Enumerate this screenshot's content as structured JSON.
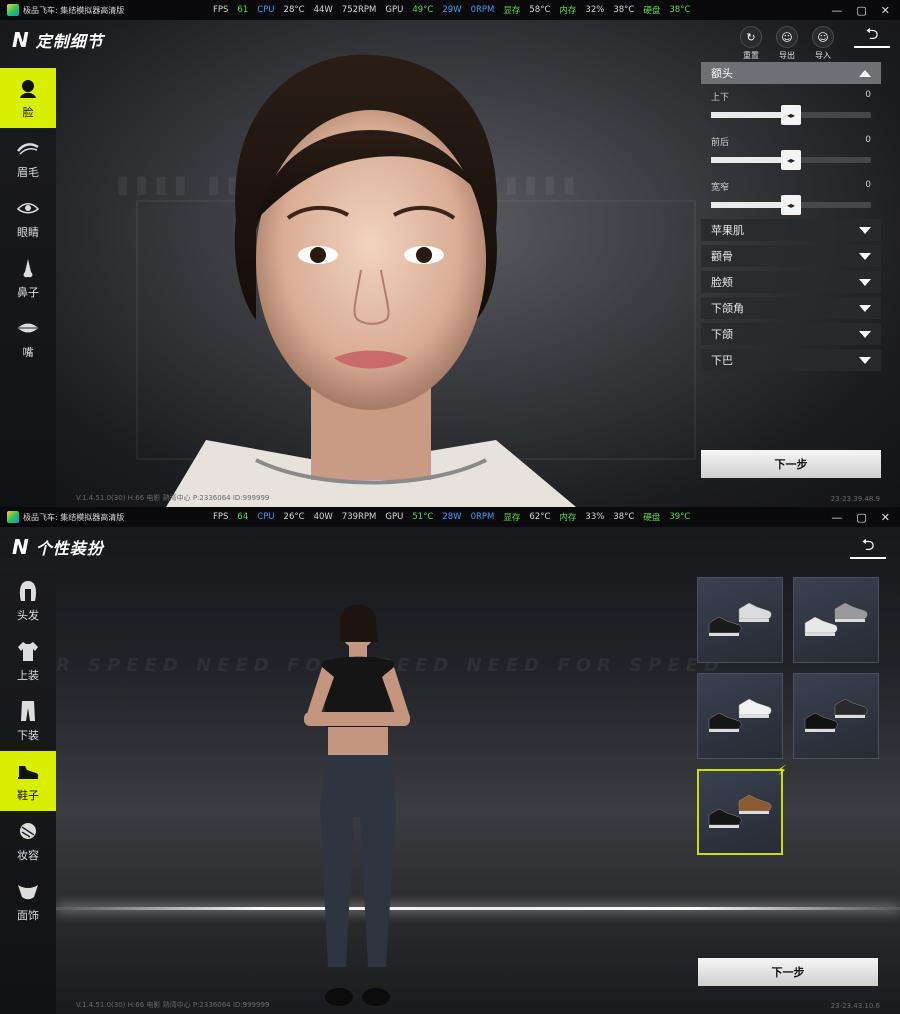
{
  "screen1": {
    "titlebar": {
      "app_name": "极品飞车: 集结模拟器高清版",
      "stats": [
        {
          "t": "FPS",
          "c": "w"
        },
        {
          "t": "61",
          "c": "g"
        },
        {
          "t": "CPU",
          "c": "b"
        },
        {
          "t": "28°C",
          "c": "w"
        },
        {
          "t": "44W",
          "c": "w"
        },
        {
          "t": "752RPM",
          "c": "w"
        },
        {
          "t": "GPU",
          "c": "w"
        },
        {
          "t": "49°C",
          "c": "g"
        },
        {
          "t": "29W",
          "c": "b"
        },
        {
          "t": "0RPM",
          "c": "b"
        },
        {
          "t": "显存",
          "c": "g"
        },
        {
          "t": "58°C",
          "c": "w"
        },
        {
          "t": "内存",
          "c": "g"
        },
        {
          "t": "32%",
          "c": "w"
        },
        {
          "t": "38°C",
          "c": "w"
        },
        {
          "t": "硬盘",
          "c": "g"
        },
        {
          "t": "38°C",
          "c": "g"
        }
      ]
    },
    "header_title": "定制细节",
    "sidebar": [
      {
        "label": "脸",
        "icon": "face-icon",
        "active": true
      },
      {
        "label": "眉毛",
        "icon": "eyebrow-icon",
        "active": false
      },
      {
        "label": "眼睛",
        "icon": "eye-icon",
        "active": false
      },
      {
        "label": "鼻子",
        "icon": "nose-icon",
        "active": false
      },
      {
        "label": "嘴",
        "icon": "mouth-icon",
        "active": false
      }
    ],
    "tools": [
      {
        "label": "重置",
        "icon": "reset-icon"
      },
      {
        "label": "导出",
        "icon": "export-icon"
      },
      {
        "label": "导入",
        "icon": "import-icon"
      }
    ],
    "panel": {
      "section": "额头",
      "sliders": [
        {
          "label": "上下",
          "value": "0",
          "fraction": 0.5
        },
        {
          "label": "前后",
          "value": "0",
          "fraction": 0.5
        },
        {
          "label": "宽窄",
          "value": "0",
          "fraction": 0.5
        }
      ],
      "collapsed": [
        "苹果肌",
        "颧骨",
        "脸颊",
        "下颌角",
        "下颌",
        "下巴"
      ]
    },
    "next_label": "下一步",
    "version_left": "V.1.4.51.0(30) H:66 电影 熟湾中心 P:2336064 ID:999999",
    "version_right": "23-23.39.48.9"
  },
  "screen2": {
    "titlebar": {
      "app_name": "极品飞车: 集结模拟器高清版",
      "stats": [
        {
          "t": "FPS",
          "c": "w"
        },
        {
          "t": "64",
          "c": "g"
        },
        {
          "t": "CPU",
          "c": "b"
        },
        {
          "t": "26°C",
          "c": "w"
        },
        {
          "t": "40W",
          "c": "w"
        },
        {
          "t": "739RPM",
          "c": "w"
        },
        {
          "t": "GPU",
          "c": "w"
        },
        {
          "t": "51°C",
          "c": "g"
        },
        {
          "t": "28W",
          "c": "b"
        },
        {
          "t": "0RPM",
          "c": "b"
        },
        {
          "t": "显存",
          "c": "g"
        },
        {
          "t": "62°C",
          "c": "w"
        },
        {
          "t": "内存",
          "c": "g"
        },
        {
          "t": "33%",
          "c": "w"
        },
        {
          "t": "38°C",
          "c": "w"
        },
        {
          "t": "硬盘",
          "c": "g"
        },
        {
          "t": "39°C",
          "c": "g"
        }
      ]
    },
    "header_title": "个性装扮",
    "bg_text": "R SPEED NEED FOR SPEED NEED FOR SPEED",
    "sidebar": [
      {
        "label": "头发",
        "icon": "hair-icon",
        "active": false
      },
      {
        "label": "上装",
        "icon": "top-clothing-icon",
        "active": false
      },
      {
        "label": "下装",
        "icon": "pants-icon",
        "active": false
      },
      {
        "label": "鞋子",
        "icon": "shoe-icon",
        "active": true
      },
      {
        "label": "妆容",
        "icon": "makeup-icon",
        "active": false
      },
      {
        "label": "面饰",
        "icon": "face-accessory-icon",
        "active": false
      }
    ],
    "cards": [
      {
        "name": "shoe-option-1",
        "colors": [
          "#1a1a1a",
          "#dcdcdc"
        ],
        "selected": false
      },
      {
        "name": "shoe-option-2",
        "colors": [
          "#e8e8e8",
          "#9a9a9a"
        ],
        "selected": false
      },
      {
        "name": "shoe-option-3",
        "colors": [
          "#161616",
          "#f2f2f2"
        ],
        "selected": false
      },
      {
        "name": "shoe-option-4",
        "colors": [
          "#111111",
          "#2a2a2a"
        ],
        "selected": false
      },
      {
        "name": "shoe-option-5",
        "colors": [
          "#151515",
          "#8a5a30"
        ],
        "selected": true
      }
    ],
    "next_label": "下一步",
    "version_left": "V.1.4.51.0(30) H:66 电影 熟湾中心 P:2336064 ID:999999",
    "version_right": "23-23.43.10.6"
  },
  "window_controls": [
    "—",
    "▢",
    "✕"
  ],
  "back_symbol": "⮌",
  "accent_color": "#d8f000"
}
